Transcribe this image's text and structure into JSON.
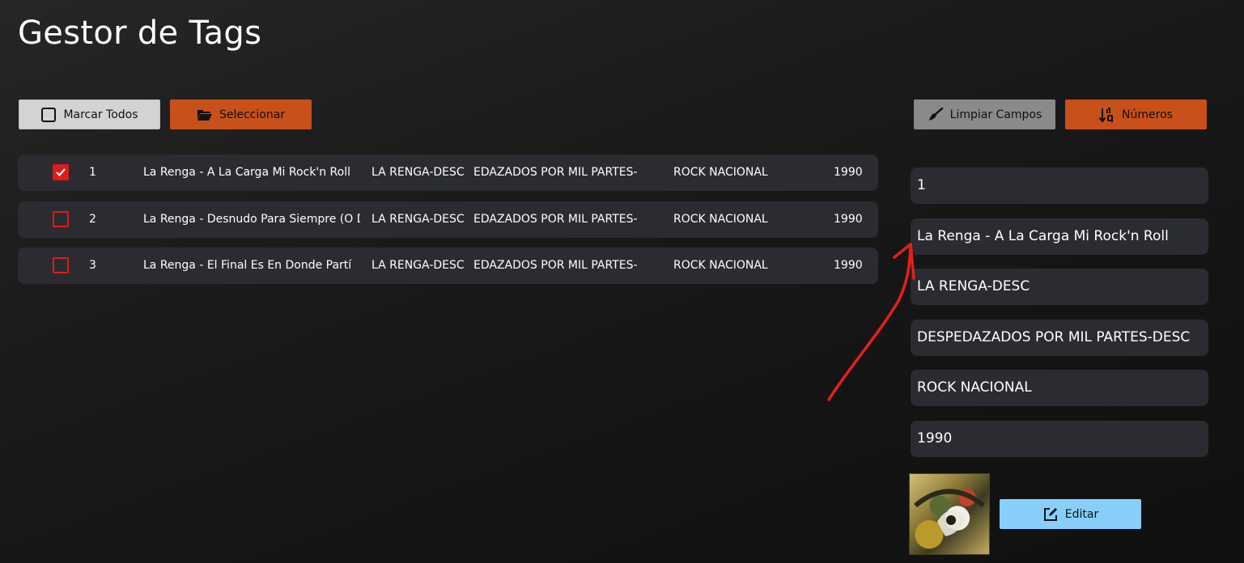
{
  "app": {
    "title": "Gestor de Tags"
  },
  "toolbar": {
    "mark_all_label": "Marcar Todos",
    "select_label": "Seleccionar",
    "clear_label": "Limpiar Campos",
    "numbers_label": "Números"
  },
  "tracks": [
    {
      "checked": true,
      "number": "1",
      "title": "La Renga - A La Carga Mi Rock'n Roll",
      "artist": "LA RENGA-DESC",
      "album": "EDAZADOS POR MIL PARTES-",
      "genre": "ROCK NACIONAL",
      "year": "1990"
    },
    {
      "checked": false,
      "number": "2",
      "title": "La Renga - Desnudo Para Siempre (O De",
      "artist": "LA RENGA-DESC",
      "album": "EDAZADOS POR MIL PARTES-",
      "genre": "ROCK NACIONAL",
      "year": "1990"
    },
    {
      "checked": false,
      "number": "3",
      "title": "La Renga - El Final Es En Donde Partí",
      "artist": "LA RENGA-DESC",
      "album": "EDAZADOS POR MIL PARTES-",
      "genre": "ROCK NACIONAL",
      "year": "1990"
    }
  ],
  "editor": {
    "track_number": "1",
    "title": "La Renga - A La Carga Mi Rock'n Roll",
    "artist": "LA RENGA-DESC",
    "album": "DESPEDAZADOS POR MIL PARTES-DESC",
    "genre": "ROCK NACIONAL",
    "year": "1990",
    "edit_label": "Editar"
  },
  "colors": {
    "accent_orange": "#c8501a",
    "checkbox_red": "#e01b1b",
    "edit_blue": "#87cefa",
    "row_bg": "#2a2c31"
  },
  "icons": {
    "mark_all": "square-outline-icon",
    "select": "folder-open-icon",
    "clear": "broom-icon",
    "numbers": "sort-numeric-icon",
    "edit": "edit-pencil-icon",
    "annotation": "red-arrow"
  }
}
